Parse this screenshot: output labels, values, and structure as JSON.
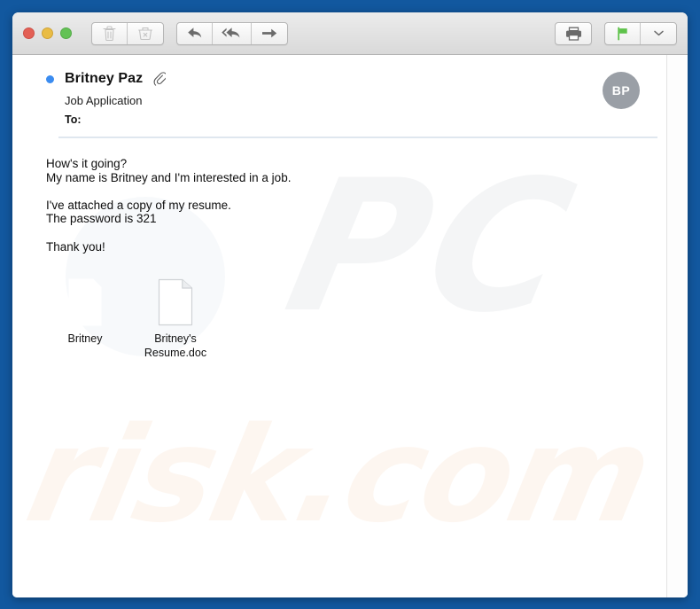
{
  "window": {
    "desktop_background": "#12589f",
    "chrome_background": "#e4e4e4"
  },
  "toolbar": {
    "traffic_lights": [
      {
        "name": "close",
        "color": "#e36055"
      },
      {
        "name": "minimize",
        "color": "#e9bc45"
      },
      {
        "name": "maximize",
        "color": "#63c255"
      }
    ],
    "buttons": [
      {
        "name": "delete-button",
        "icon": "trash-icon",
        "label": "Delete",
        "enabled": false
      },
      {
        "name": "junk-button",
        "icon": "junk-basket-icon",
        "label": "Junk",
        "enabled": false
      },
      {
        "name": "reply-button",
        "icon": "reply-arrow-icon",
        "label": "Reply",
        "enabled": true
      },
      {
        "name": "reply-all-button",
        "icon": "reply-all-arrow-icon",
        "label": "Reply All",
        "enabled": true
      },
      {
        "name": "forward-button",
        "icon": "forward-arrow-icon",
        "label": "Forward",
        "enabled": true
      },
      {
        "name": "print-button",
        "icon": "printer-icon",
        "label": "Print",
        "enabled": true
      },
      {
        "name": "flag-button",
        "icon": "flag-icon",
        "label": "Flag",
        "enabled": true,
        "color": "#5ec24a"
      },
      {
        "name": "flag-dropdown-button",
        "icon": "chevron-down-icon",
        "label": "Flag options",
        "enabled": true
      }
    ]
  },
  "message": {
    "unread": true,
    "sender": "Britney Paz",
    "has_attachment_indicator": true,
    "subject": "Job Application",
    "to_label": "To:",
    "to_value": "",
    "avatar_initials": "BP",
    "body_lines": [
      "How's it going?",
      "My name is Britney and I'm interested in a job.",
      "",
      "I've attached a copy of my resume.",
      "The password is 321",
      "",
      "Thank you!"
    ],
    "attachments": [
      {
        "name": "Britney",
        "icon": "vcard-icon"
      },
      {
        "name": "Britney's Resume.doc",
        "icon": "document-icon"
      }
    ]
  },
  "watermarks": {
    "primary": "PC",
    "secondary": "risk.com",
    "primary_color": "#f4f5f6",
    "secondary_color": "#fdf6f0"
  }
}
